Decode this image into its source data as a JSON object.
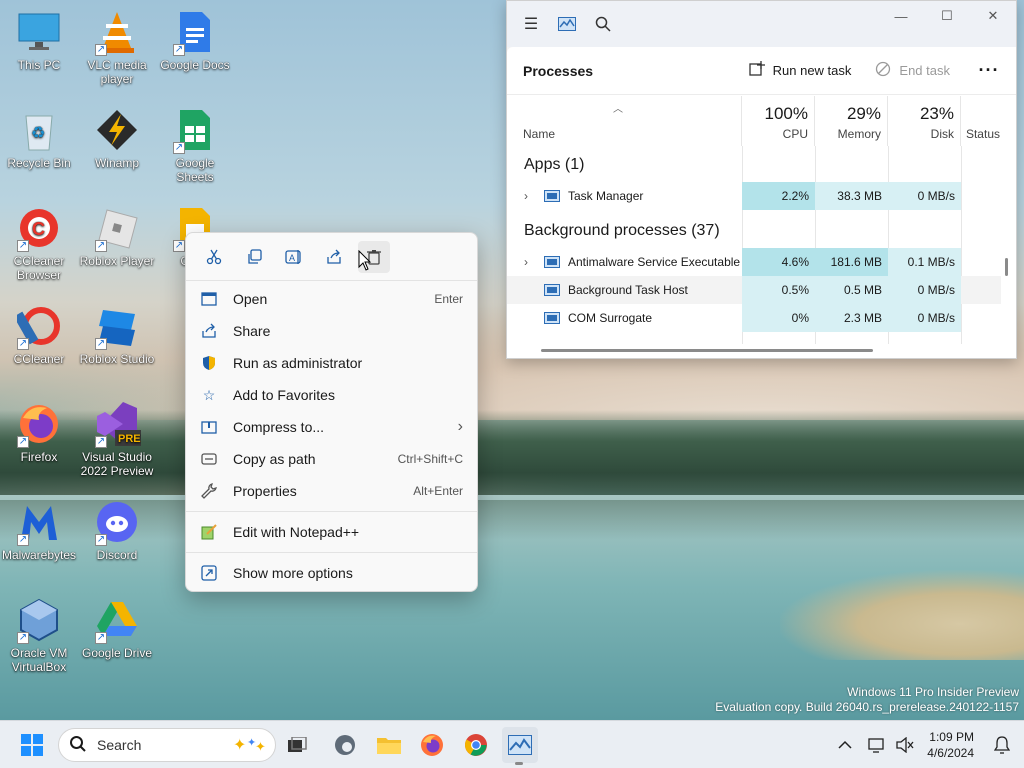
{
  "desktop": {
    "icons": [
      {
        "label": "This PC",
        "icon": "monitor-icon"
      },
      {
        "label": "VLC media player",
        "icon": "vlc-icon"
      },
      {
        "label": "Google Docs",
        "icon": "docs-icon"
      },
      {
        "label": "Recycle Bin",
        "icon": "recycle-bin-icon"
      },
      {
        "label": "Winamp",
        "icon": "winamp-icon"
      },
      {
        "label": "Google Sheets",
        "icon": "sheets-icon"
      },
      {
        "label": "CCleaner Browser",
        "icon": "ccleaner-browser-icon"
      },
      {
        "label": "Roblox Player",
        "icon": "roblox-icon"
      },
      {
        "label": "Goog",
        "icon": "slides-icon"
      },
      {
        "label": "CCleaner",
        "icon": "ccleaner-icon"
      },
      {
        "label": "Roblox Studio",
        "icon": "roblox-studio-icon"
      },
      {
        "label": "Firefox",
        "icon": "firefox-icon"
      },
      {
        "label": "Visual Studio 2022 Preview",
        "icon": "visual-studio-icon",
        "badge": "PRE"
      },
      {
        "label": "Malwarebytes",
        "icon": "malwarebytes-icon"
      },
      {
        "label": "Discord",
        "icon": "discord-icon"
      },
      {
        "label": "Oracle VM VirtualBox",
        "icon": "virtualbox-icon"
      },
      {
        "label": "Google Drive",
        "icon": "drive-icon"
      }
    ],
    "watermark": {
      "line1": "Windows 11 Pro Insider Preview",
      "line2": "Evaluation copy. Build 26040.rs_prerelease.240122-1157"
    }
  },
  "task_manager": {
    "section_title": "Processes",
    "run_new_task": "Run new task",
    "end_task": "End task",
    "more": "···",
    "columns": {
      "name": "Name",
      "cpu_pct": "100%",
      "cpu": "CPU",
      "mem_pct": "29%",
      "mem": "Memory",
      "disk_pct": "23%",
      "disk": "Disk",
      "status": "Status"
    },
    "groups": {
      "apps": "Apps (1)",
      "background": "Background processes (37)"
    },
    "rows": [
      {
        "name": "Task Manager",
        "cpu": "2.2%",
        "mem": "38.3 MB",
        "disk": "0 MB/s",
        "expandable": true
      },
      {
        "name": "Antimalware Service Executable",
        "cpu": "4.6%",
        "mem": "181.6 MB",
        "disk": "0.1 MB/s",
        "expandable": true
      },
      {
        "name": "Background Task Host",
        "cpu": "0.5%",
        "mem": "0.5 MB",
        "disk": "0 MB/s",
        "expandable": false
      },
      {
        "name": "COM Surrogate",
        "cpu": "0%",
        "mem": "2.3 MB",
        "disk": "0 MB/s",
        "expandable": false
      }
    ]
  },
  "context_menu": {
    "quick_actions": [
      {
        "icon": "cut-icon",
        "glyph": "✂"
      },
      {
        "icon": "copy-icon",
        "glyph": "⧉"
      },
      {
        "icon": "rename-icon",
        "glyph": "Ⓐ"
      },
      {
        "icon": "share-icon",
        "glyph": "⇪"
      },
      {
        "icon": "delete-icon",
        "glyph": "🗑"
      }
    ],
    "items": [
      {
        "label": "Open",
        "shortcut": "Enter",
        "icon": "open-icon",
        "glyph": "▣"
      },
      {
        "label": "Share",
        "shortcut": "",
        "icon": "share-icon",
        "glyph": "⇪"
      },
      {
        "label": "Run as administrator",
        "shortcut": "",
        "icon": "shield-icon",
        "glyph": "⛨"
      },
      {
        "label": "Add to Favorites",
        "shortcut": "",
        "icon": "star-icon",
        "glyph": "☆"
      },
      {
        "label": "Compress to...",
        "shortcut": "",
        "icon": "zip-icon",
        "glyph": "▤",
        "submenu": "›"
      },
      {
        "label": "Copy as path",
        "shortcut": "Ctrl+Shift+C",
        "icon": "path-icon",
        "glyph": "⌨"
      },
      {
        "label": "Properties",
        "shortcut": "Alt+Enter",
        "icon": "wrench-icon",
        "glyph": "🔧"
      },
      {
        "label": "Edit with Notepad++",
        "shortcut": "",
        "icon": "notepadpp-icon",
        "glyph": "✎"
      },
      {
        "label": "Show more options",
        "shortcut": "",
        "icon": "more-options-icon",
        "glyph": "⧉"
      }
    ]
  },
  "taskbar": {
    "search_label": "Search",
    "time": "1:09 PM",
    "date": "4/6/2024"
  }
}
